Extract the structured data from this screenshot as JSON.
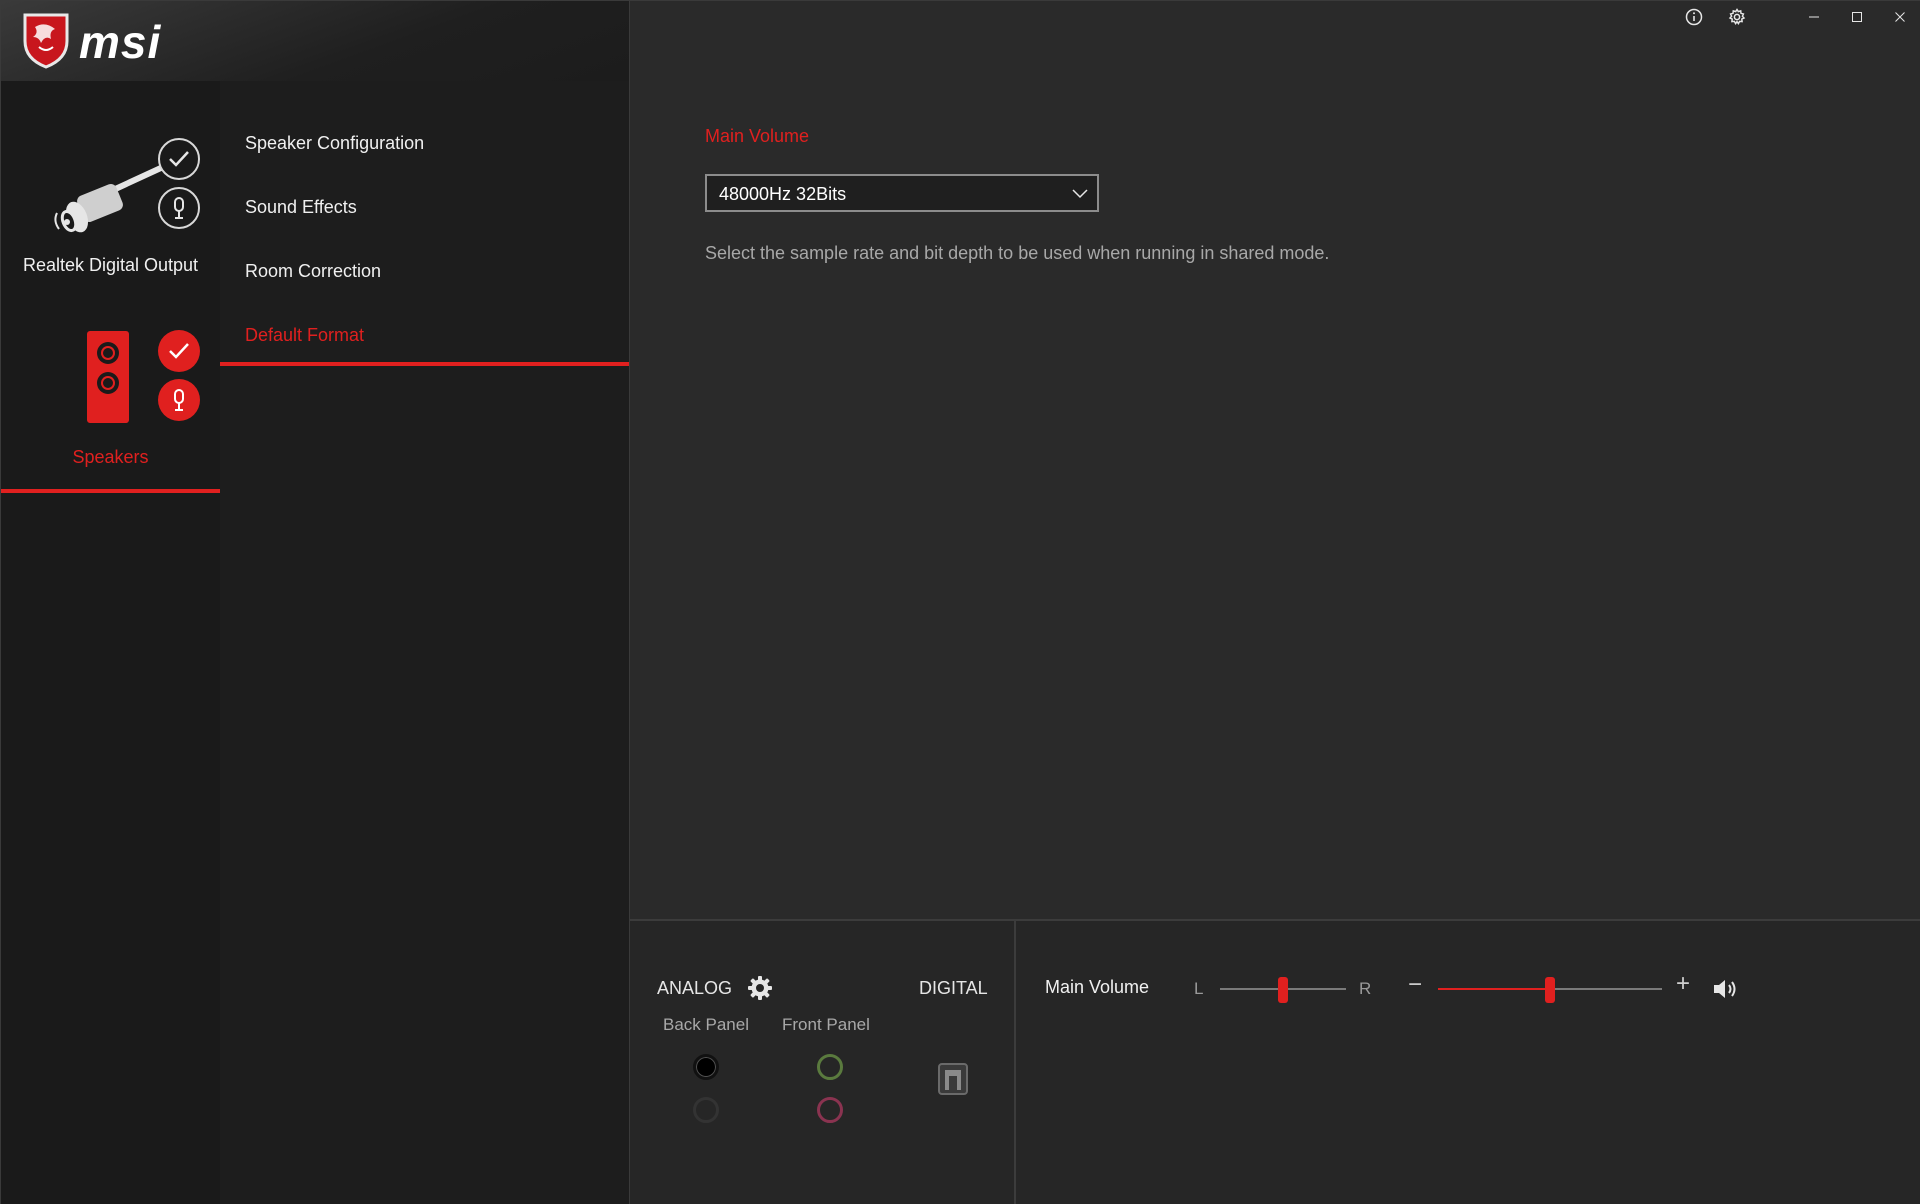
{
  "app": {
    "logo_text": "msi",
    "accent_color": "#e0201f"
  },
  "devices": [
    {
      "name": "Realtek Digital Output",
      "icon": "digital-plug-icon",
      "selected": false
    },
    {
      "name": "Speakers",
      "icon": "speaker-icon",
      "selected": true
    }
  ],
  "menu": {
    "items": [
      {
        "label": "Speaker Configuration",
        "active": false
      },
      {
        "label": "Sound Effects",
        "active": false
      },
      {
        "label": "Room Correction",
        "active": false
      },
      {
        "label": "Default Format",
        "active": true
      }
    ]
  },
  "main": {
    "section_title": "Main Volume",
    "format_select": {
      "value": "48000Hz 32Bits"
    },
    "description": "Select the sample rate and bit depth to be used when running in shared mode."
  },
  "window_controls": [
    "info-icon",
    "settings-icon",
    "minimize-icon",
    "maximize-icon",
    "close-icon"
  ],
  "bottom": {
    "analog_label": "ANALOG",
    "digital_label": "DIGITAL",
    "back_panel_label": "Back Panel",
    "front_panel_label": "Front Panel",
    "jacks": {
      "back_panel": [
        {
          "color": "#000000",
          "active": true
        },
        {
          "color": "#2e2e2e",
          "active": false
        }
      ],
      "front_panel": [
        {
          "color": "#4e6b35",
          "active": false
        },
        {
          "color": "#7a2d45",
          "active": false
        }
      ]
    },
    "volume": {
      "label": "Main Volume",
      "balance_left_label": "L",
      "balance_right_label": "R",
      "balance_fraction": 0.5,
      "volume_fraction": 0.5,
      "minus_label": "−",
      "plus_label": "+"
    }
  }
}
